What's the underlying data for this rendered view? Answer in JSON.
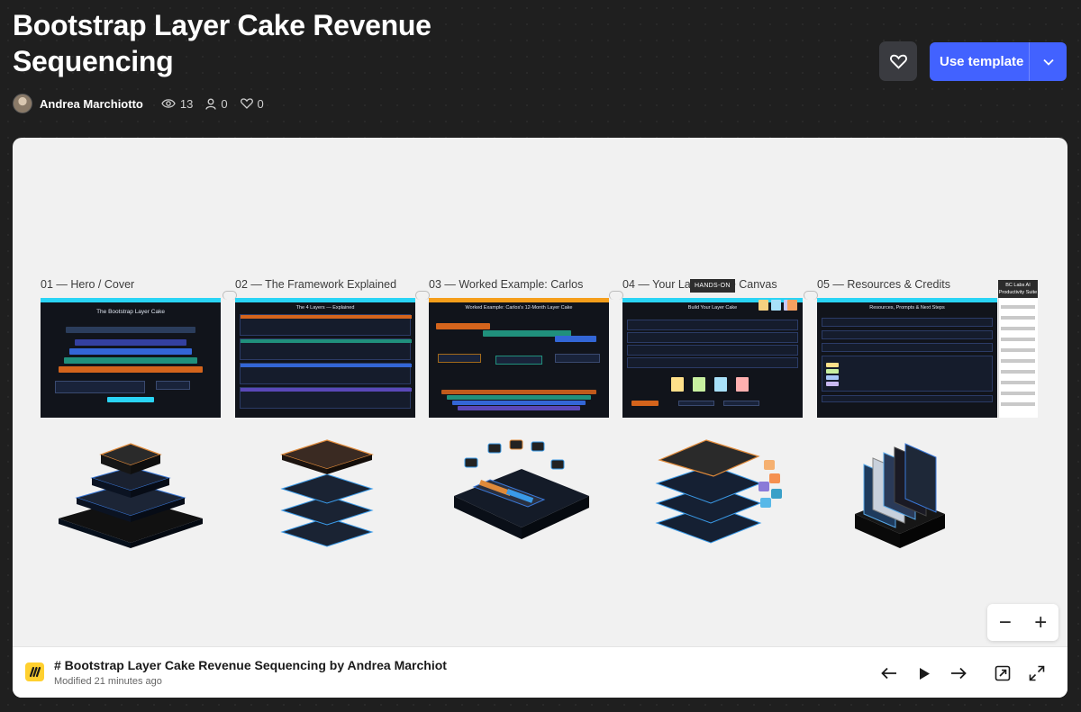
{
  "header": {
    "title": "Bootstrap Layer Cake Revenue Sequencing",
    "author": "Andrea Marchiotto",
    "views": "13",
    "users": "0",
    "likes": "0"
  },
  "actions": {
    "use_template": "Use template"
  },
  "board": {
    "frames": [
      {
        "label": "01 — Hero / Cover",
        "inner_title": "The Bootstrap Layer Cake",
        "accent": "#2ad4f5"
      },
      {
        "label": "02 — The Framework Explained",
        "inner_title": "The 4 Layers — Explained",
        "accent": "#2ad4f5"
      },
      {
        "label": "03 — Worked Example: Carlos",
        "inner_title": "Worked Example: Carlos's 12-Month Layer Cake",
        "accent": "#f59e1b"
      },
      {
        "label": "04 — Your Layer Cake Canvas",
        "inner_title": "Build Your Layer Cake",
        "accent": "#2ad4f5"
      },
      {
        "label": "05 — Resources & Credits",
        "inner_title": "Resources, Prompts & Next Steps",
        "accent": "#2ad4f5"
      }
    ],
    "hands_on_tag": "HANDS-ON",
    "suite_note": "BC Labs AI Productivity Suite",
    "footer_title": "# Bootstrap Layer Cake Revenue Sequencing by Andrea Marchiot",
    "footer_modified": "Modified 21 minutes ago"
  },
  "colors": {
    "background": "#1f1f1f",
    "primary": "#4262ff",
    "board": "#f1f1f1",
    "miro_yellow": "#ffd02f"
  },
  "icons": [
    "heart-icon",
    "eye-icon",
    "user-icon",
    "chevron-down-icon",
    "minus-icon",
    "plus-icon",
    "arrow-left-icon",
    "play-icon",
    "arrow-right-icon",
    "open-external-icon",
    "fullscreen-icon",
    "miro-logo-icon"
  ]
}
